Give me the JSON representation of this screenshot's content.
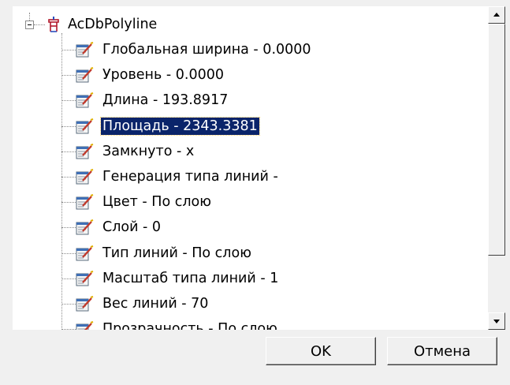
{
  "tree": {
    "root": {
      "label": "AcDbPolyline",
      "icon": "polyline-object-icon"
    },
    "items": [
      {
        "label": "Глобальная ширина - 0.0000",
        "icon": "property-icon"
      },
      {
        "label": "Уровень - 0.0000",
        "icon": "property-icon"
      },
      {
        "label": "Длина - 193.8917",
        "icon": "property-icon"
      },
      {
        "label": "Площадь - 2343.3381",
        "icon": "property-icon",
        "selected": true
      },
      {
        "label": "Замкнуто - x",
        "icon": "property-icon"
      },
      {
        "label": "Генерация типа линий -",
        "icon": "property-icon"
      },
      {
        "label": "Цвет - По слою",
        "icon": "property-icon"
      },
      {
        "label": "Слой - 0",
        "icon": "property-icon"
      },
      {
        "label": "Тип линий - По слою",
        "icon": "property-icon"
      },
      {
        "label": "Масштаб типа линий - 1",
        "icon": "property-icon"
      },
      {
        "label": "Вес линий - 70",
        "icon": "property-icon"
      },
      {
        "label": "Прозрачность - По слою",
        "icon": "property-icon"
      }
    ]
  },
  "buttons": {
    "ok_label": "OK",
    "cancel_label": "Отмена"
  },
  "colors": {
    "selection": "#0a246a",
    "window": "#f0f0f0"
  }
}
